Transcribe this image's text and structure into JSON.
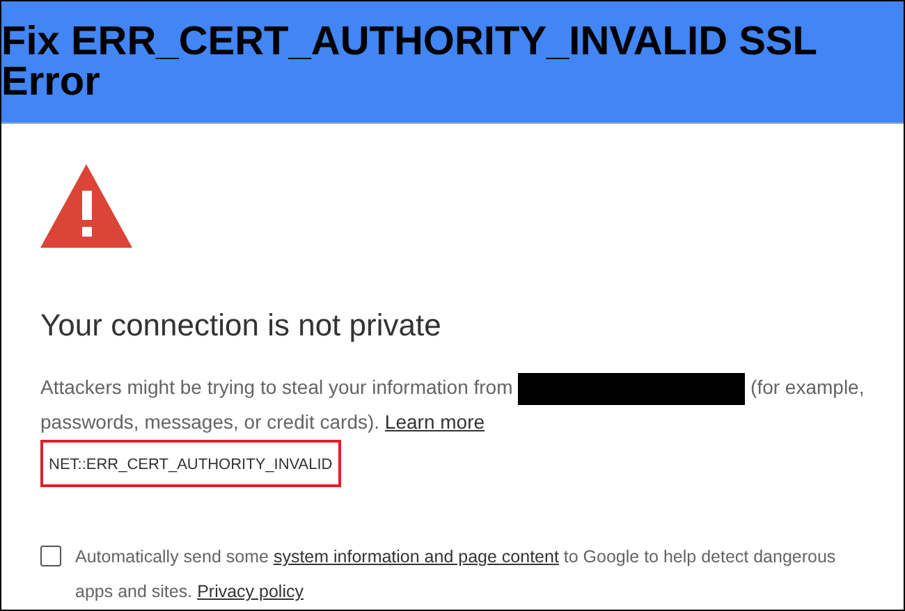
{
  "banner": {
    "title": "Fix ERR_CERT_AUTHORITY_INVALID SSL Error"
  },
  "interstitial": {
    "heading": "Your connection is not private",
    "message_before": "Attackers might be trying to steal your information from",
    "redacted": true,
    "message_after": "(for example, passwords, messages, or credit cards).",
    "learn_more_link": "Learn more",
    "error_code": "NET::ERR_CERT_AUTHORITY_INVALID",
    "error_code_highlighted": true
  },
  "report_option": {
    "checked": false,
    "text_before": "Automatically send some",
    "link": "system information and page content",
    "text_after": "to Google to help detect dangerous apps and sites.",
    "privacy_link": "Privacy policy"
  }
}
